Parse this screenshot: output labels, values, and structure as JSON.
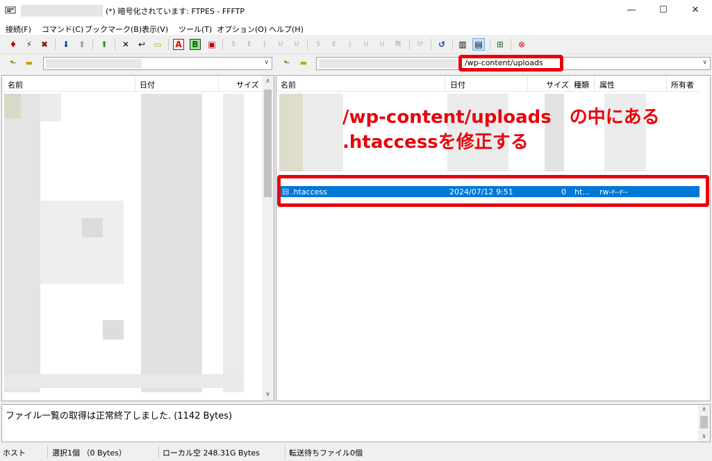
{
  "window": {
    "title": "(*) 暗号化されています: FTPES - FFFTP",
    "minimize": "—",
    "maximize": "☐",
    "close": "✕"
  },
  "menu": [
    "接続(F)",
    "コマンド(C)",
    "ブックマーク(B)",
    "表示(V)",
    "ツール(T)",
    "オプション(O)",
    "ヘルプ(H)"
  ],
  "toolbar": {
    "connect": "connect-icon",
    "quick_connect": "lightning-icon",
    "disconnect": "disconnect-icon",
    "download": "download-arrow-icon",
    "upload": "upload-arrow-icon",
    "mirror_upload": "mirror-upload-icon",
    "delete": "delete-icon",
    "rename": "rename-icon",
    "mkdir": "new-folder-icon",
    "ascii_mode": "A",
    "binary_mode": "B",
    "auto_mode": "auto-mode-icon",
    "kanji_buttons": [
      "S",
      "E",
      "J",
      "U",
      "U"
    ],
    "kanji_buttons_remote": [
      "S",
      "E",
      "J",
      "U",
      "U",
      "無"
    ],
    "kana_button": "ｶﾅ",
    "refresh": "refresh-icon",
    "list_view": "list-view-icon",
    "detail_view": "detail-view-icon",
    "sync_tree": "tree-icon",
    "stop": "stop-icon"
  },
  "local": {
    "columns": [
      "名前",
      "日付",
      "サイズ"
    ]
  },
  "remote": {
    "path": "/wp-content/uploads",
    "columns": [
      "名前",
      "日付",
      "サイズ",
      "種類",
      "属性",
      "所有者"
    ],
    "files": [
      {
        "name": ".htaccess",
        "date": "2024/07/12",
        "time": "9:51",
        "size": "0",
        "type": "ht...",
        "attr": "rw-r--r--",
        "selected": true
      }
    ]
  },
  "annotation": {
    "line1": "/wp-content/uploads　の中にある",
    "line2": ".htaccessを修正する",
    "color": "#e8000b"
  },
  "log": {
    "message": "ファイル一覧の取得は正常終了しました. (1142 Bytes)"
  },
  "status": {
    "host": "ホスト",
    "selection": "選択1個 （0 Bytes）",
    "local_free": "ローカル空 248.31G Bytes",
    "queue": "転送待ちファイル0個"
  },
  "colors": {
    "selection": "#0078d7",
    "highlight": "#e8000b"
  }
}
